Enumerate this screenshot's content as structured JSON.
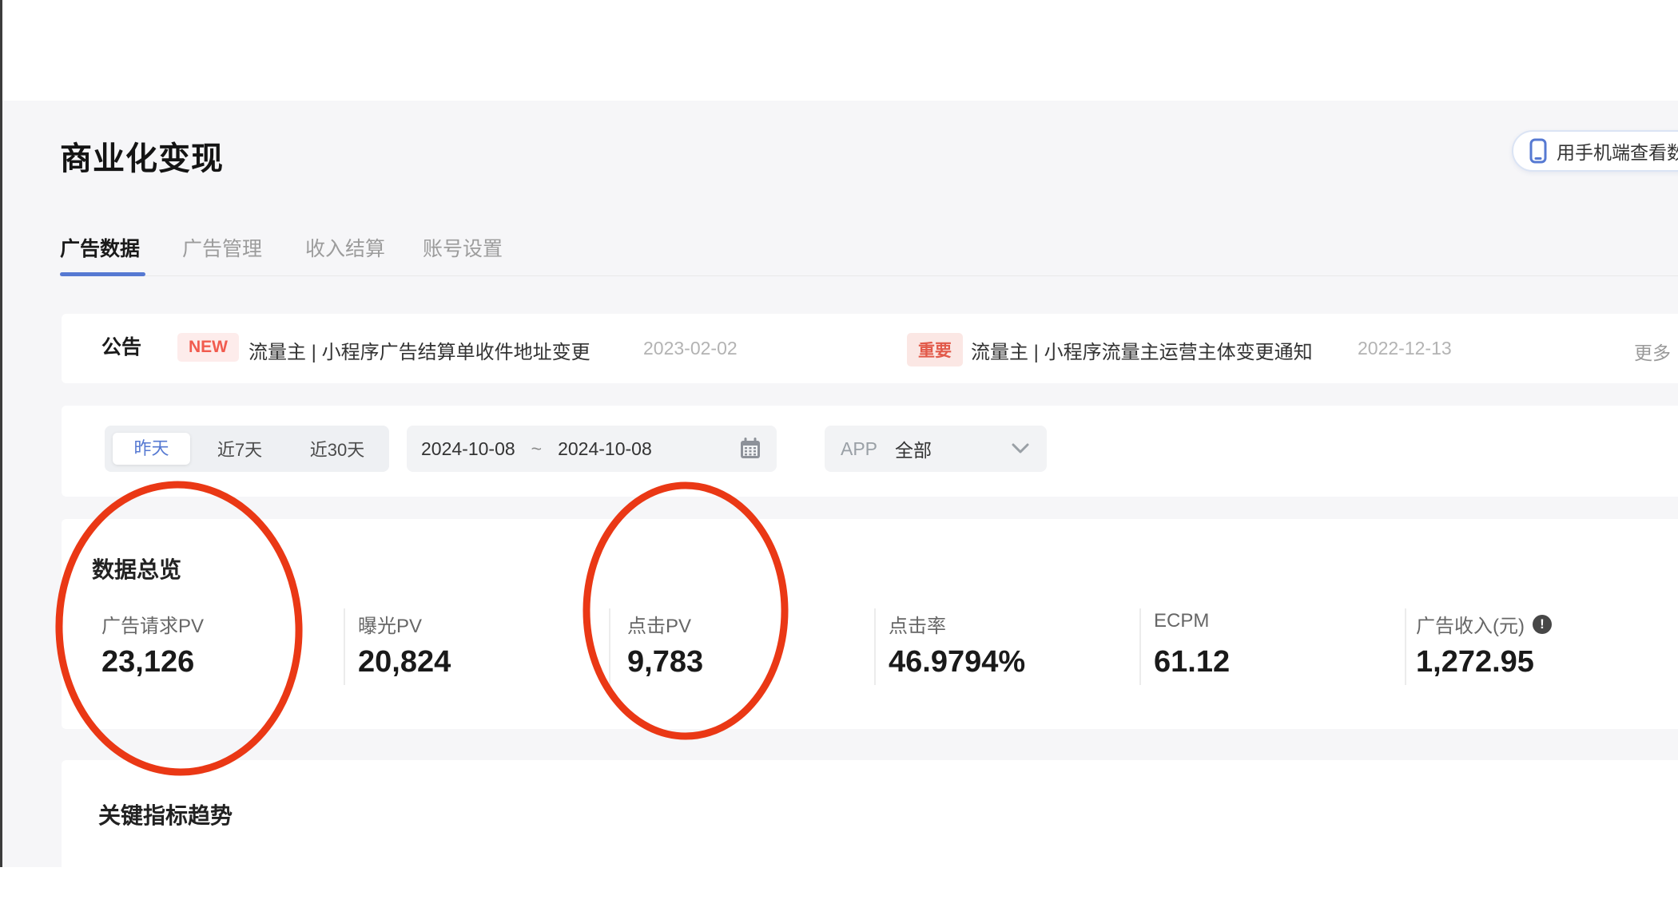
{
  "page": {
    "title": "商业化变现",
    "phone_button_label": "用手机端查看数据",
    "tabs": [
      {
        "label": "广告数据",
        "active": true
      },
      {
        "label": "广告管理",
        "active": false
      },
      {
        "label": "收入结算",
        "active": false
      },
      {
        "label": "账号设置",
        "active": false
      }
    ],
    "announcement": {
      "label": "公告",
      "more_label": "更多",
      "items": [
        {
          "badge": "NEW",
          "title": "流量主 | 小程序广告结算单收件地址变更",
          "date": "2023-02-02"
        },
        {
          "badge": "重要",
          "title": "流量主 | 小程序流量主运营主体变更通知",
          "date": "2022-12-13"
        }
      ]
    },
    "filters": {
      "quick_ranges": [
        {
          "label": "昨天",
          "selected": true
        },
        {
          "label": "近7天",
          "selected": false
        },
        {
          "label": "近30天",
          "selected": false
        }
      ],
      "date_start": "2024-10-08",
      "date_separator": "~",
      "date_end": "2024-10-08",
      "app_label": "APP",
      "app_value": "全部"
    },
    "overview": {
      "heading": "数据总览",
      "metrics": [
        {
          "label": "广告请求PV",
          "value": "23,126",
          "circled": true
        },
        {
          "label": "曝光PV",
          "value": "20,824",
          "circled": false
        },
        {
          "label": "点击PV",
          "value": "9,783",
          "circled": true
        },
        {
          "label": "点击率",
          "value": "46.9794%",
          "circled": false
        },
        {
          "label": "ECPM",
          "value": "61.12",
          "circled": false
        },
        {
          "label": "广告收入(元)",
          "value": "1,272.95",
          "circled": false
        }
      ],
      "info_icon_glyph": "!"
    },
    "trend": {
      "heading": "关键指标趋势"
    },
    "colors": {
      "accent_blue": "#5679d2",
      "annotation_red": "#ea3815",
      "badge_red": "#f15b4e",
      "badge_bg": "#fdeceb",
      "page_bg": "#f6f6f8",
      "card_bg": "#ffffff"
    }
  }
}
